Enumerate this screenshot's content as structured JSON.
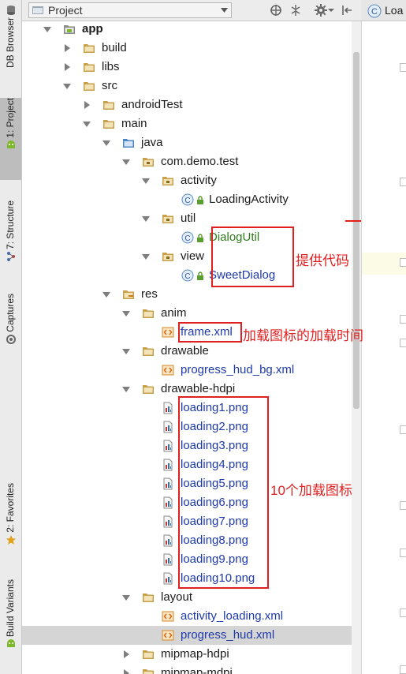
{
  "sidebar": {
    "tabs": [
      {
        "label": "DB Browser",
        "active": false,
        "icon": "db-icon"
      },
      {
        "label": "1: Project",
        "active": true,
        "icon": "android-project-icon"
      },
      {
        "label": "7: Structure",
        "active": false,
        "icon": "structure-icon"
      },
      {
        "label": "Captures",
        "active": false,
        "icon": "captures-icon"
      },
      {
        "label": "2: Favorites",
        "active": false,
        "icon": "star-icon"
      },
      {
        "label": "Build Variants",
        "active": false,
        "icon": "android-icon"
      }
    ]
  },
  "header": {
    "view_selector": "Project",
    "buttons": [
      "target-icon",
      "collapse-icon",
      "gear-icon",
      "hide-icon"
    ]
  },
  "editor": {
    "tab_label": "Loa",
    "tab_icon": "C"
  },
  "tree": {
    "items": [
      {
        "label": "app",
        "kind": "module"
      },
      {
        "label": "build",
        "kind": "folder"
      },
      {
        "label": "libs",
        "kind": "folder"
      },
      {
        "label": "src",
        "kind": "folder"
      },
      {
        "label": "androidTest",
        "kind": "folder"
      },
      {
        "label": "main",
        "kind": "folder"
      },
      {
        "label": "java",
        "kind": "source-folder"
      },
      {
        "label": "com.demo.test",
        "kind": "package"
      },
      {
        "label": "activity",
        "kind": "package"
      },
      {
        "label": "LoadingActivity",
        "kind": "class"
      },
      {
        "label": "util",
        "kind": "package"
      },
      {
        "label": "DialogUtil",
        "kind": "class"
      },
      {
        "label": "view",
        "kind": "package"
      },
      {
        "label": "SweetDialog",
        "kind": "class"
      },
      {
        "label": "res",
        "kind": "res-folder"
      },
      {
        "label": "anim",
        "kind": "folder"
      },
      {
        "label": "frame.xml",
        "kind": "xml"
      },
      {
        "label": "drawable",
        "kind": "folder"
      },
      {
        "label": "progress_hud_bg.xml",
        "kind": "xml"
      },
      {
        "label": "drawable-hdpi",
        "kind": "folder"
      },
      {
        "label": "loading1.png",
        "kind": "png"
      },
      {
        "label": "loading2.png",
        "kind": "png"
      },
      {
        "label": "loading3.png",
        "kind": "png"
      },
      {
        "label": "loading4.png",
        "kind": "png"
      },
      {
        "label": "loading5.png",
        "kind": "png"
      },
      {
        "label": "loading6.png",
        "kind": "png"
      },
      {
        "label": "loading7.png",
        "kind": "png"
      },
      {
        "label": "loading8.png",
        "kind": "png"
      },
      {
        "label": "loading9.png",
        "kind": "png"
      },
      {
        "label": "loading10.png",
        "kind": "png"
      },
      {
        "label": "layout",
        "kind": "folder"
      },
      {
        "label": "activity_loading.xml",
        "kind": "xml"
      },
      {
        "label": "progress_hud.xml",
        "kind": "xml",
        "selected": true
      },
      {
        "label": "mipmap-hdpi",
        "kind": "folder"
      },
      {
        "label": "mipmap-mdpi",
        "kind": "folder"
      }
    ]
  },
  "annotations": {
    "code_note": "提供代码",
    "frame_note": "加载图标的加载时间",
    "icons_note": "10个加载图标"
  },
  "colors": {
    "annotation": "#e02020",
    "selected_row": "#d5d5d5",
    "file_blue": "#1e3aa8",
    "class_green": "#2f7a1e",
    "folder": "#c9a04a"
  }
}
